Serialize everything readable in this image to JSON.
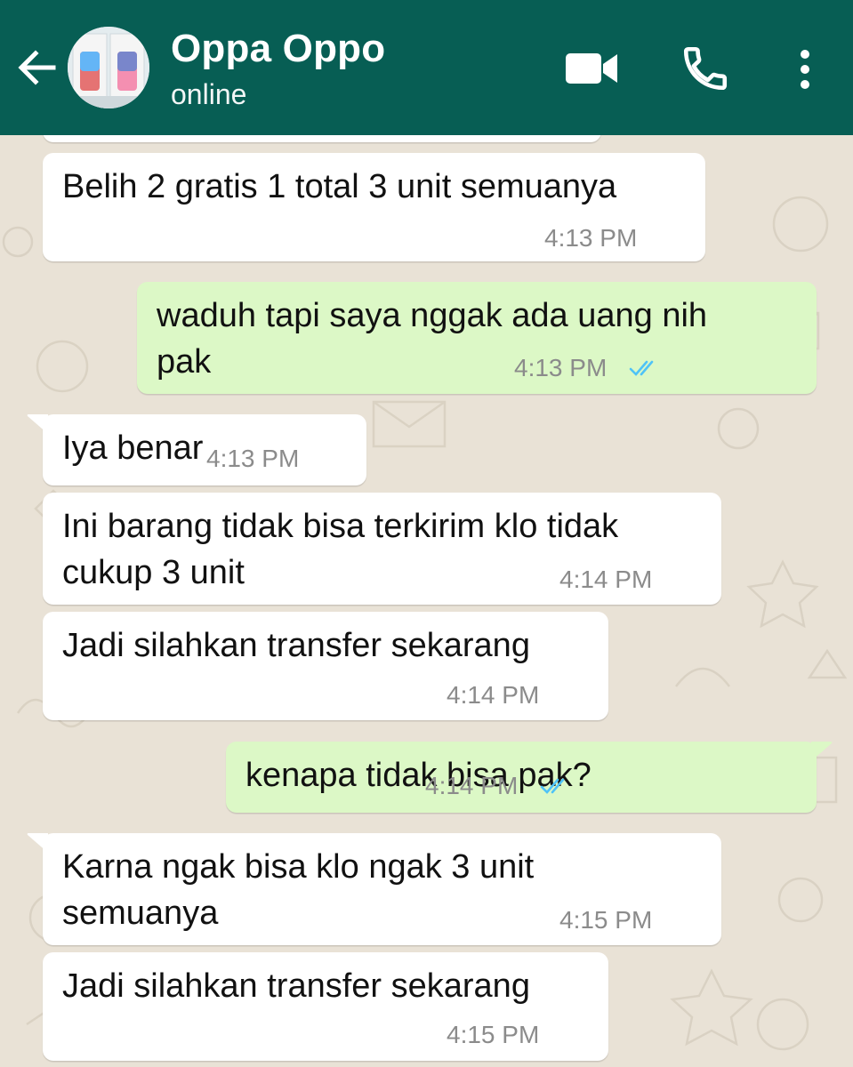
{
  "header": {
    "contact_name": "Oppa Oppo",
    "status": "online",
    "colors": {
      "bar": "#075e54",
      "text": "#ffffff"
    },
    "icons": [
      "back-arrow-icon",
      "video-call-icon",
      "phone-call-icon",
      "more-options-icon"
    ]
  },
  "chat": {
    "colors": {
      "incoming": "#ffffff",
      "outgoing": "#dcf8c6",
      "read_ticks": "#4fc3f7",
      "background": "#e9e2d6"
    },
    "messages": [
      {
        "direction": "in",
        "lines": [
          "Belih 2 gratis 1 total 3 unit semuanya"
        ],
        "time": "4:13 PM"
      },
      {
        "direction": "out",
        "lines": [
          "waduh tapi saya nggak ada uang nih",
          "pak"
        ],
        "time": "4:13 PM",
        "status": "read"
      },
      {
        "direction": "in",
        "lines": [
          "Iya benar"
        ],
        "time": "4:13 PM"
      },
      {
        "direction": "in",
        "lines": [
          "Ini barang tidak bisa terkirim klo tidak",
          "cukup 3 unit"
        ],
        "time": "4:14 PM"
      },
      {
        "direction": "in",
        "lines": [
          "Jadi silahkan transfer sekarang"
        ],
        "time": "4:14 PM"
      },
      {
        "direction": "out",
        "lines": [
          "kenapa tidak bisa pak?"
        ],
        "time": "4:14 PM",
        "status": "read"
      },
      {
        "direction": "in",
        "lines": [
          "Karna ngak bisa klo ngak 3 unit",
          "semuanya"
        ],
        "time": "4:15 PM"
      },
      {
        "direction": "in",
        "lines": [
          "Jadi silahkan transfer sekarang"
        ],
        "time": "4:15 PM"
      }
    ]
  }
}
